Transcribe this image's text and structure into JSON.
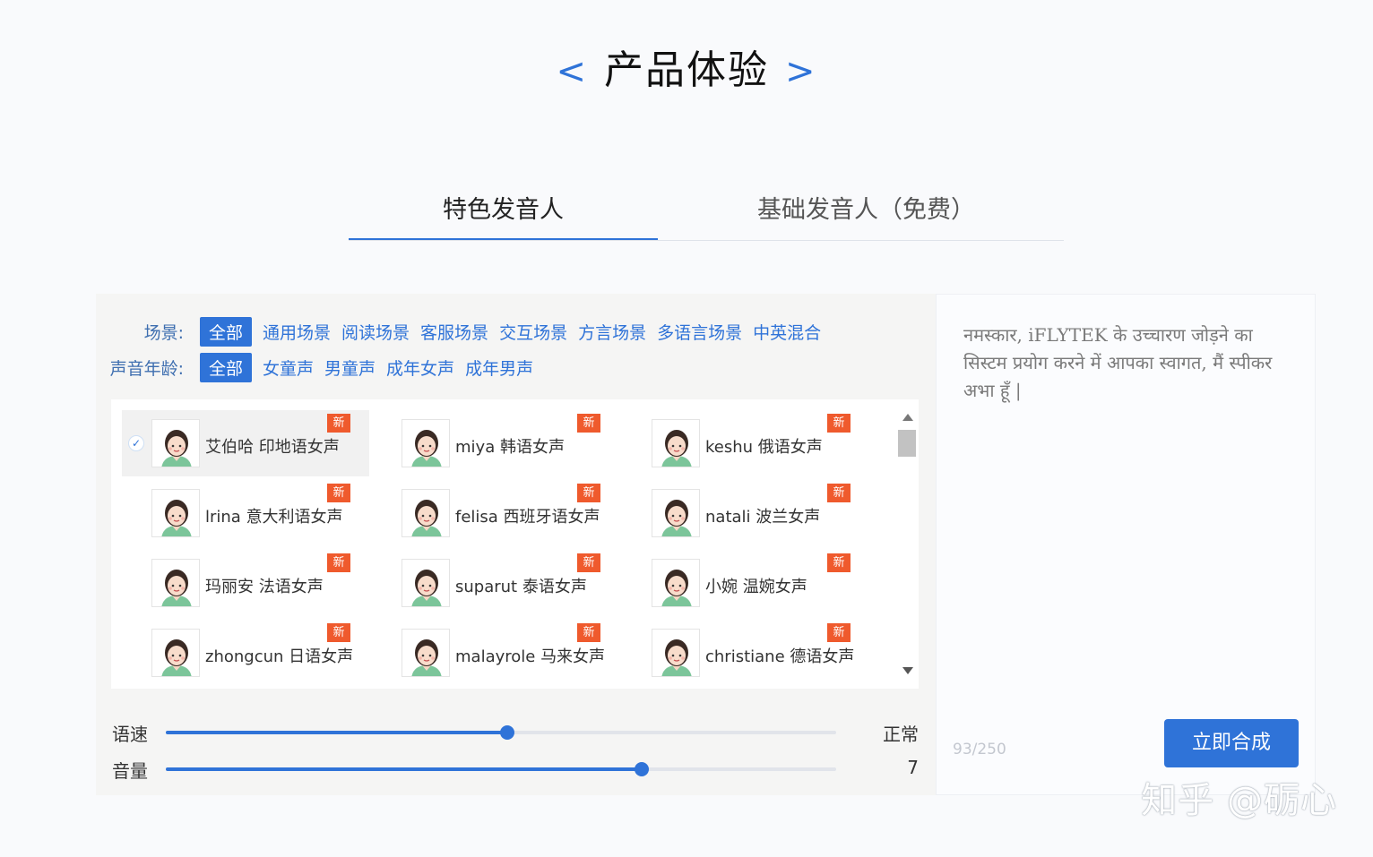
{
  "title": {
    "left_arrow": "<",
    "text": "产品体验",
    "right_arrow": ">"
  },
  "tabs": [
    {
      "label": "特色发音人",
      "active": true
    },
    {
      "label": "基础发音人（免费）",
      "active": false
    }
  ],
  "filters": {
    "scene": {
      "label": "场景:",
      "options": [
        "全部",
        "通用场景",
        "阅读场景",
        "客服场景",
        "交互场景",
        "方言场景",
        "多语言场景",
        "中英混合"
      ],
      "selected": "全部"
    },
    "age": {
      "label": "声音年龄:",
      "options": [
        "全部",
        "女童声",
        "男童声",
        "成年女声",
        "成年男声"
      ],
      "selected": "全部"
    }
  },
  "speakers": [
    {
      "name": "艾伯哈 印地语女声",
      "badge": "新",
      "selected": true
    },
    {
      "name": "miya  韩语女声",
      "badge": "新",
      "selected": false
    },
    {
      "name": "keshu 俄语女声",
      "badge": "新",
      "selected": false
    },
    {
      "name": "lrina   意大利语女声",
      "badge": "新",
      "selected": false
    },
    {
      "name": "felisa 西班牙语女声",
      "badge": "新",
      "selected": false
    },
    {
      "name": "natali 波兰女声",
      "badge": "新",
      "selected": false
    },
    {
      "name": "玛丽安 法语女声",
      "badge": "新",
      "selected": false
    },
    {
      "name": "suparut 泰语女声",
      "badge": "新",
      "selected": false
    },
    {
      "name": "小婉   温婉女声",
      "badge": "新",
      "selected": false
    },
    {
      "name": "zhongcun 日语女声",
      "badge": "新",
      "selected": false
    },
    {
      "name": "malayrole 马来女声",
      "badge": "新",
      "selected": false
    },
    {
      "name": "christiane 德语女声",
      "badge": "新",
      "selected": false
    }
  ],
  "sliders": {
    "speed": {
      "label": "语速",
      "value_text": "正常",
      "fraction": 0.51
    },
    "volume": {
      "label": "音量",
      "value_text": "7",
      "fraction": 0.71
    }
  },
  "text_input": {
    "value": "नमस्कार, iFLYTEK के उच्चारण जोड़ने का सिस्टम प्रयोग करने में आपका स्वागत, मैं स्पीकर अभा हूँ |",
    "counter": "93/250"
  },
  "synth_button": "立即合成",
  "watermark": "知乎 @砺心",
  "colors": {
    "accent": "#2f73d8",
    "badge": "#ef5a2d"
  }
}
